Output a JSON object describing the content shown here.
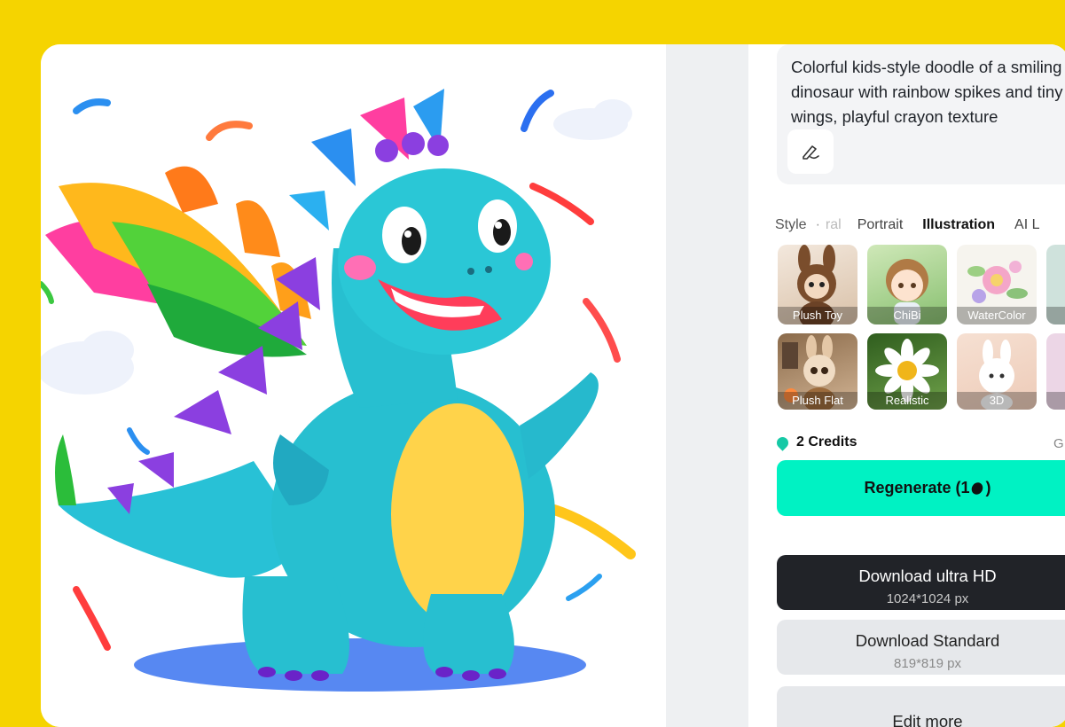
{
  "prompt": {
    "text": "Colorful kids-style doodle of a smiling dinosaur with rainbow spikes and tiny wings, playful crayon texture",
    "edit_icon": "pen-edit-icon"
  },
  "style_tabs": {
    "label": "Style",
    "dot": "·",
    "faded": "ral",
    "items": [
      "Portrait",
      "Illustration",
      "AI L"
    ],
    "active": "Illustration"
  },
  "styles": [
    {
      "label": "Plush Toy"
    },
    {
      "label": "ChiBi"
    },
    {
      "label": "WaterColor"
    },
    {
      "label": ""
    },
    {
      "label": "Plush Flat"
    },
    {
      "label": "Realistic"
    },
    {
      "label": "3D"
    },
    {
      "label": ""
    }
  ],
  "credits": {
    "text": "2 Credits",
    "side": "G",
    "icon": "credits-drop-icon"
  },
  "regenerate": {
    "label": "Regenerate (1",
    "close": ")",
    "icon": "bean-icon"
  },
  "download_hd": {
    "label": "Download ultra HD",
    "size": "1024*1024 px"
  },
  "download_standard": {
    "label": "Download Standard",
    "size": "819*819 px"
  },
  "edit_more": {
    "label": "Edit more"
  },
  "colors": {
    "background": "#f5d400",
    "accent": "#00f2c3",
    "dark": "#212328"
  }
}
